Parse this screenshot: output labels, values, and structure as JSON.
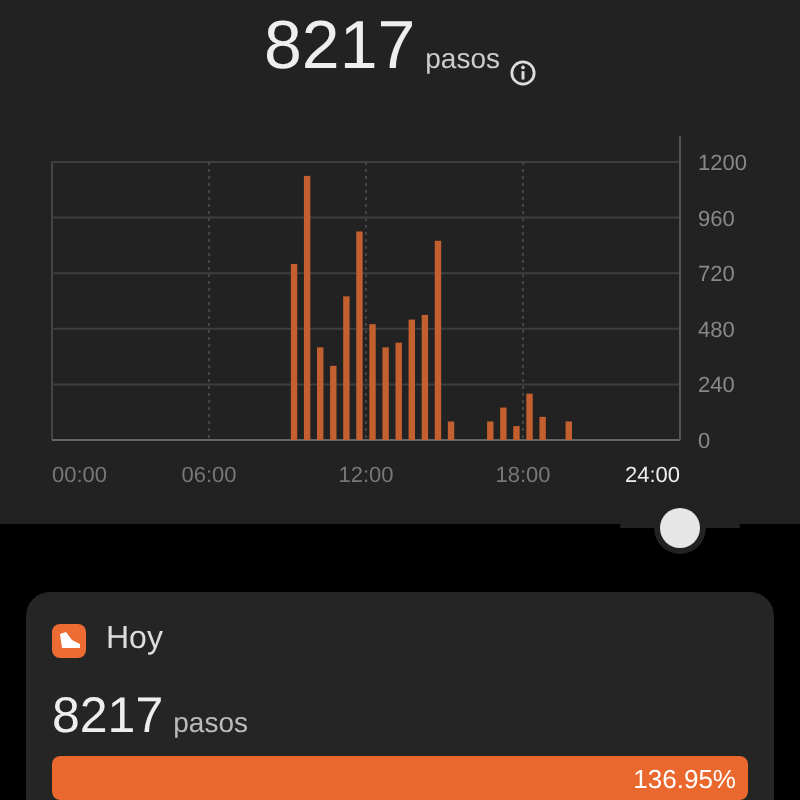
{
  "summary": {
    "value": "8217",
    "unit": "pasos"
  },
  "chart": {
    "chart_data": {
      "type": "bar",
      "grid": true,
      "x": [
        9.25,
        9.75,
        10.25,
        10.75,
        11.25,
        11.75,
        12.25,
        12.75,
        13.25,
        13.75,
        14.25,
        14.75,
        15.25,
        16.75,
        17.25,
        17.75,
        18.25,
        18.75,
        19.75
      ],
      "series": [
        {
          "color": "#c4602f",
          "values": [
            760,
            1140,
            400,
            320,
            620,
            900,
            500,
            400,
            420,
            520,
            540,
            860,
            80,
            80,
            140,
            60,
            200,
            100,
            80
          ]
        }
      ],
      "xlim": [
        0,
        24
      ],
      "ylim": [
        0,
        1200
      ],
      "xticks": [
        {
          "value": 0,
          "label": "00:00"
        },
        {
          "value": 6,
          "label": "06:00"
        },
        {
          "value": 12,
          "label": "12:00"
        },
        {
          "value": 18,
          "label": "18:00"
        },
        {
          "value": 24,
          "label": "24:00"
        }
      ],
      "yticks": [
        0,
        240,
        480,
        720,
        960,
        1200
      ]
    }
  },
  "card": {
    "title": "Hoy",
    "value": "8217",
    "unit": "pasos",
    "progress": {
      "level": 1,
      "reading": "136.95%"
    }
  }
}
